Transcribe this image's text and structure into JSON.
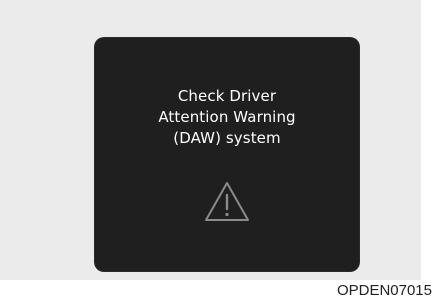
{
  "display": {
    "message_lines": [
      "Check Driver",
      "Attention Warning",
      "(DAW) system"
    ],
    "icon": "warning-triangle-icon"
  },
  "caption": {
    "code": "OPDEN07015"
  },
  "colors": {
    "backdrop": "#ebebeb",
    "display_background": "#1f1f1f",
    "text": "#ffffff",
    "icon_stroke": "#8a8a8a"
  }
}
